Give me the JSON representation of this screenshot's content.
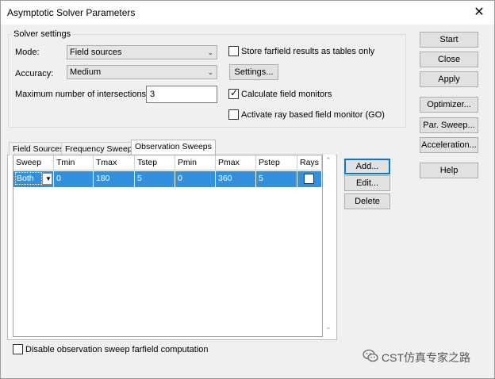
{
  "window": {
    "title": "Asymptotic Solver Parameters"
  },
  "solver_settings": {
    "group_label": "Solver settings",
    "mode_label": "Mode:",
    "mode_value": "Field sources",
    "accuracy_label": "Accuracy:",
    "accuracy_value": "Medium",
    "max_intersections_label": "Maximum number of intersections:",
    "max_intersections_value": "3",
    "store_farfield_label": "Store farfield results as tables only",
    "store_farfield_checked": false,
    "settings_button": "Settings...",
    "calc_monitors_label": "Calculate field monitors",
    "calc_monitors_checked": true,
    "activate_ray_label": "Activate ray based field monitor (GO)",
    "activate_ray_checked": false
  },
  "right_buttons": {
    "start": "Start",
    "close": "Close",
    "apply": "Apply",
    "optimizer": "Optimizer...",
    "par_sweep": "Par. Sweep...",
    "acceleration": "Acceleration...",
    "help": "Help"
  },
  "tabs": [
    {
      "label": "Field Sources",
      "active": false
    },
    {
      "label": "Frequency Sweeps",
      "active": false
    },
    {
      "label": "Observation Sweeps",
      "active": true
    }
  ],
  "table": {
    "columns": [
      "Sweep",
      "Tmin",
      "Tmax",
      "Tstep",
      "Pmin",
      "Pmax",
      "Pstep",
      "Rays"
    ],
    "rows": [
      {
        "sweep": "Both",
        "tmin": "0",
        "tmax": "180",
        "tstep": "5",
        "pmin": "0",
        "pmax": "360",
        "pstep": "5",
        "rays": false
      }
    ]
  },
  "table_buttons": {
    "add": "Add...",
    "edit": "Edit...",
    "delete": "Delete"
  },
  "disable_sweep_label": "Disable observation sweep farfield computation",
  "disable_sweep_checked": false,
  "watermark": "CST仿真专家之路",
  "colors": {
    "selection": "#3390dc",
    "default_button_border": "#0078d7"
  }
}
